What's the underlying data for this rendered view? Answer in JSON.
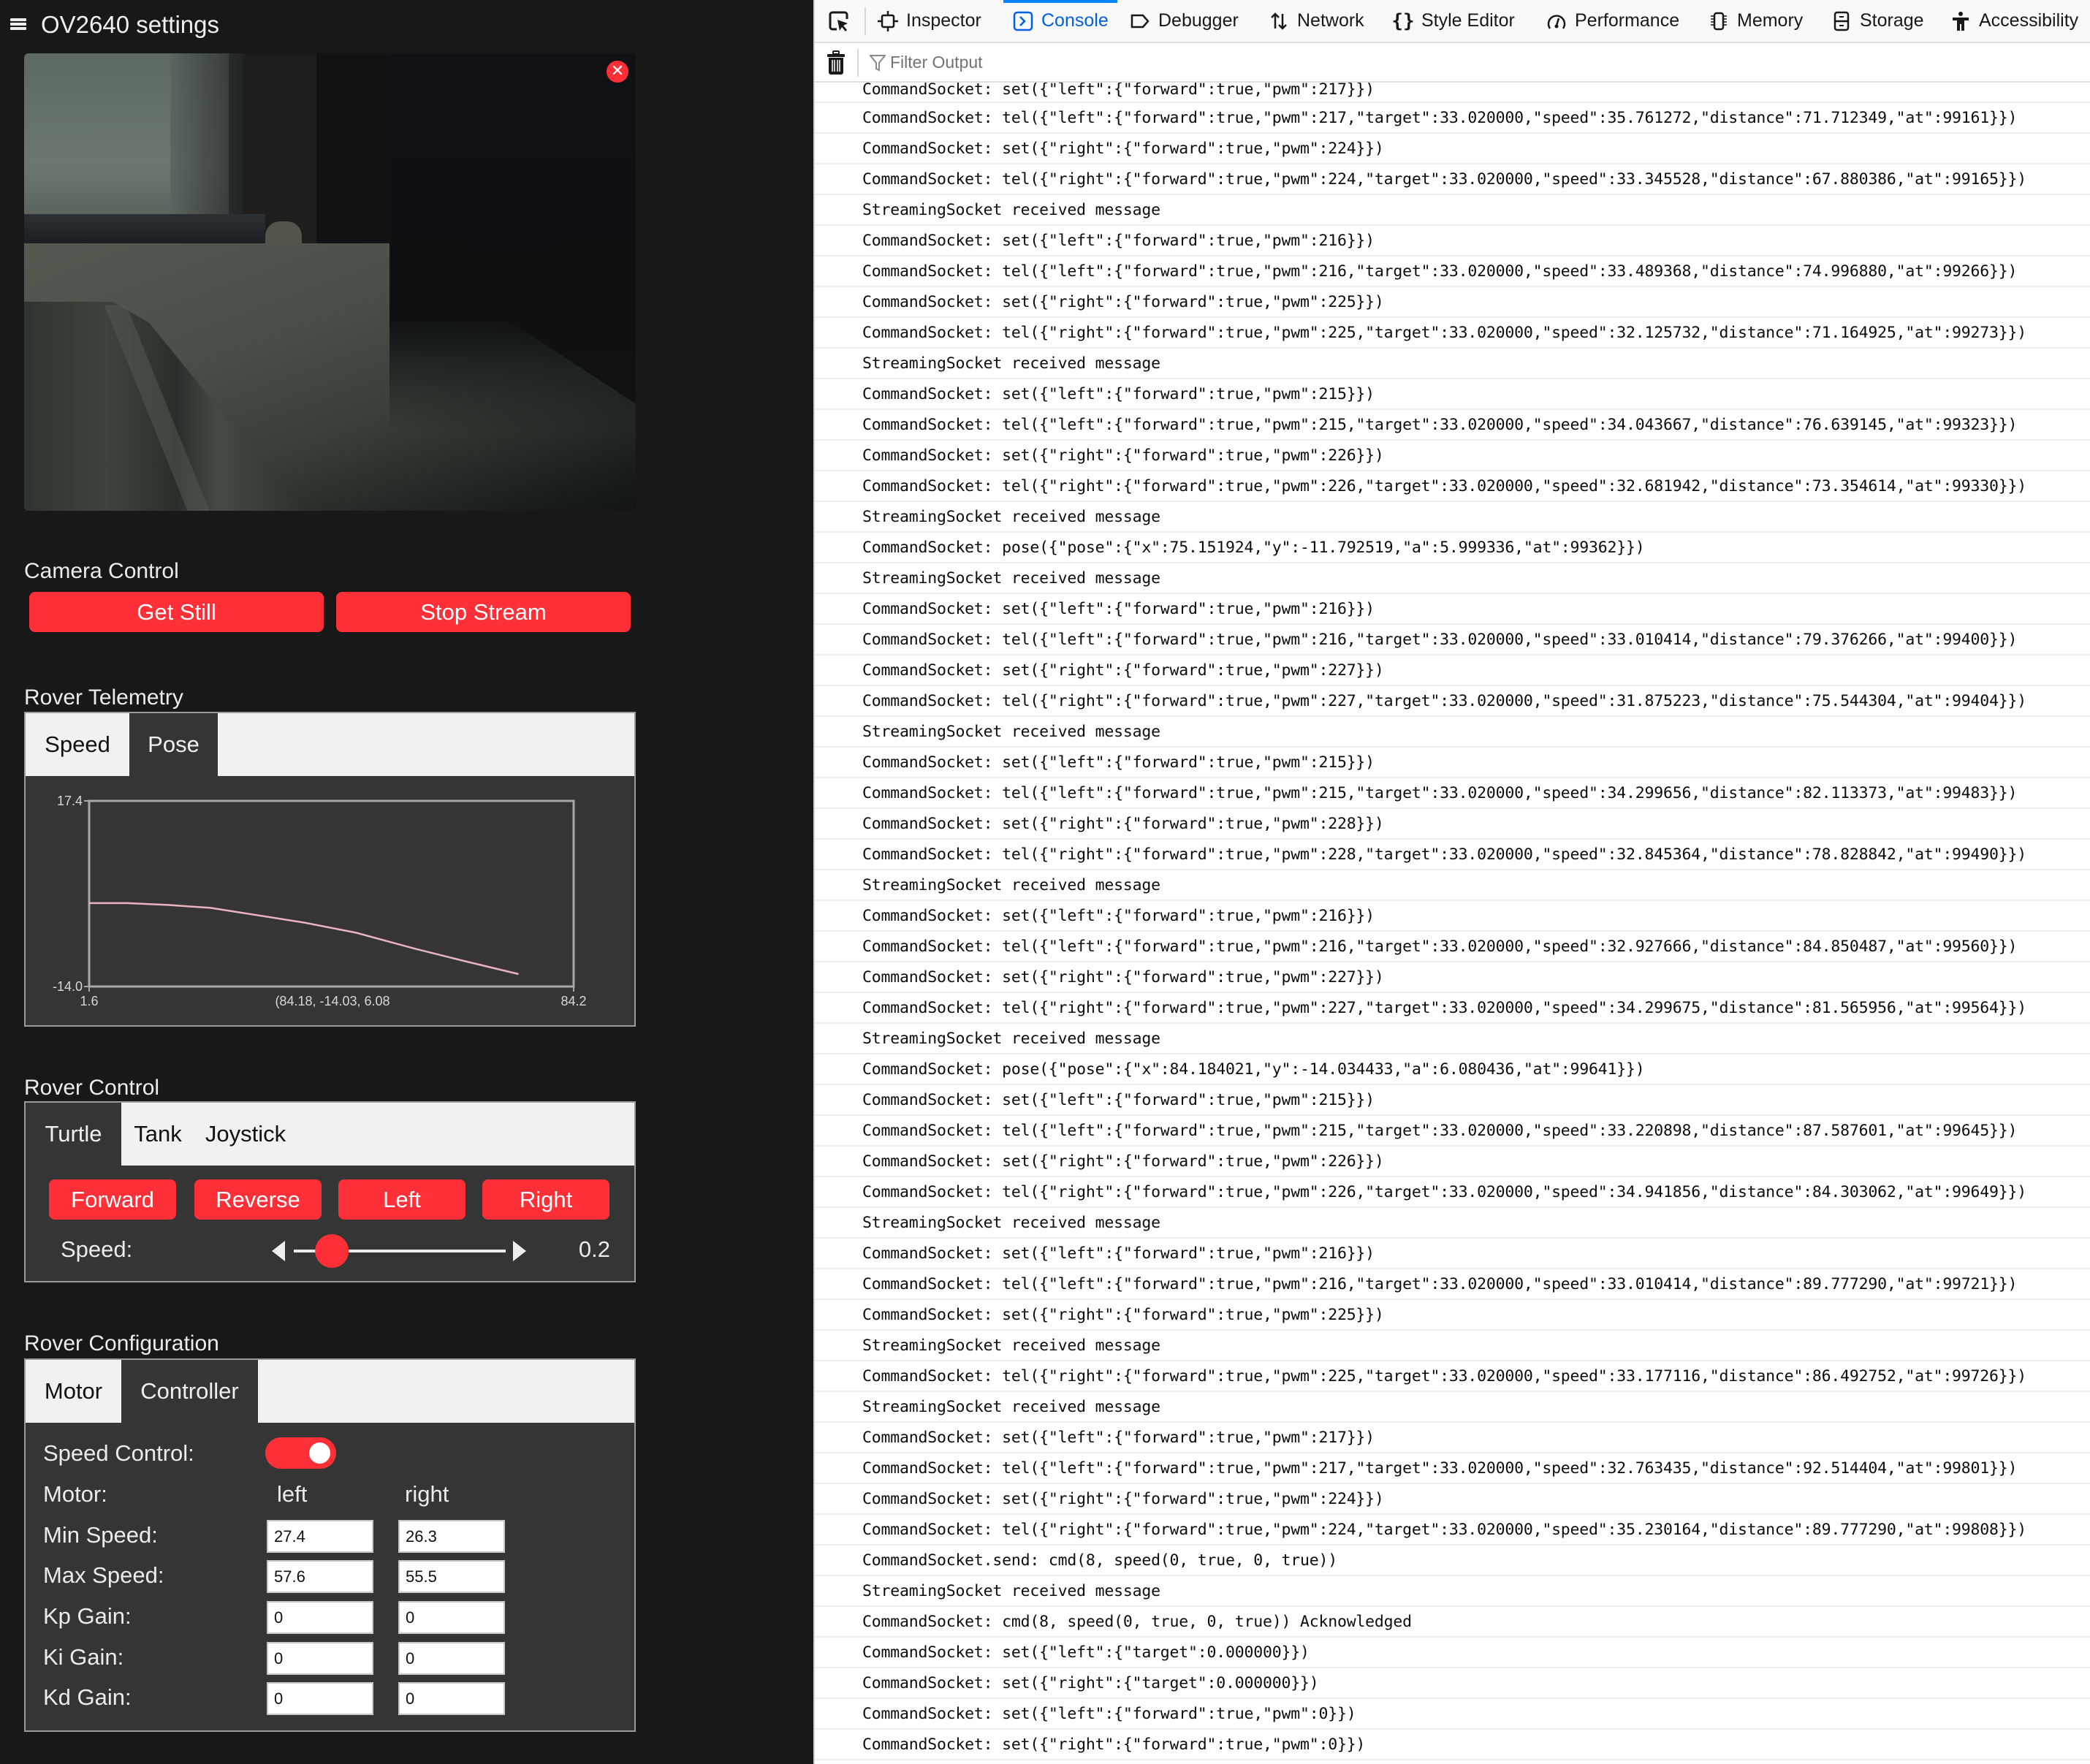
{
  "app": {
    "title": "OV2640 settings",
    "menu_icon": "hamburger-icon",
    "camera": {
      "close_icon": "close-icon",
      "close_glyph": "✕"
    },
    "camera_control": {
      "title": "Camera Control",
      "get_still_label": "Get Still",
      "stop_stream_label": "Stop Stream"
    },
    "telemetry": {
      "title": "Rover Telemetry",
      "tabs": [
        {
          "label": "Speed",
          "active": false
        },
        {
          "label": "Pose",
          "active": true
        }
      ]
    },
    "rover_control": {
      "title": "Rover Control",
      "tabs": [
        {
          "label": "Turtle",
          "active": true
        },
        {
          "label": "Tank",
          "active": false
        },
        {
          "label": "Joystick",
          "active": false
        }
      ],
      "buttons": [
        "Forward",
        "Reverse",
        "Left",
        "Right"
      ],
      "speed_label": "Speed:",
      "speed_value": "0.2",
      "speed_fraction": 0.2
    },
    "rover_config": {
      "title": "Rover Configuration",
      "tabs": [
        {
          "label": "Motor",
          "active": false
        },
        {
          "label": "Controller",
          "active": true
        }
      ],
      "speed_control_label": "Speed Control:",
      "speed_control_on": true,
      "motor_label": "Motor:",
      "left_header": "left",
      "right_header": "right",
      "rows": [
        {
          "label": "Min Speed:",
          "left": "27.4",
          "right": "26.3"
        },
        {
          "label": "Max Speed:",
          "left": "57.6",
          "right": "55.5"
        },
        {
          "label": "Kp Gain:",
          "left": "0",
          "right": "0"
        },
        {
          "label": "Ki Gain:",
          "left": "0",
          "right": "0"
        },
        {
          "label": "Kd Gain:",
          "left": "0",
          "right": "0"
        }
      ]
    },
    "colors": {
      "accent": "#ff2f37",
      "panel": "#353535",
      "background": "#181818",
      "trail": "#e8b4be"
    }
  },
  "chart_data": {
    "type": "line",
    "title": "",
    "xlabel": "",
    "ylabel": "",
    "x_tick_labels": [
      "1.6",
      "84.2"
    ],
    "y_tick_labels": [
      "17.4",
      "-14.0"
    ],
    "xlim": [
      1.6,
      84.2
    ],
    "ylim": [
      -14.0,
      17.4
    ],
    "annotation": "(84.18, -14.03, 6.08",
    "grid": false,
    "series": [
      {
        "name": "pose-trail",
        "x": [
          1.6,
          8.0,
          15.0,
          22.3,
          30.0,
          38.3,
          47.1,
          57.1,
          66.0,
          74.8
        ],
        "y": [
          0.1,
          0.1,
          -0.2,
          -0.7,
          -1.9,
          -3.2,
          -4.9,
          -7.6,
          -9.8,
          -11.9
        ]
      }
    ]
  },
  "devtools": {
    "tabs": [
      {
        "label": "Inspector",
        "icon": "inspector-icon",
        "active": false
      },
      {
        "label": "Console",
        "icon": "console-icon",
        "active": true
      },
      {
        "label": "Debugger",
        "icon": "debugger-icon",
        "active": false
      },
      {
        "label": "Network",
        "icon": "network-icon",
        "active": false
      },
      {
        "label": "Style Editor",
        "icon": "style-editor-icon",
        "active": false
      },
      {
        "label": "Performance",
        "icon": "performance-icon",
        "active": false
      },
      {
        "label": "Memory",
        "icon": "memory-icon",
        "active": false
      },
      {
        "label": "Storage",
        "icon": "storage-icon",
        "active": false
      },
      {
        "label": "Accessibility",
        "icon": "accessibility-icon",
        "active": false
      }
    ],
    "picker_icon": "element-picker-icon",
    "clear_icon": "trash-icon",
    "filter_placeholder": "Filter Output",
    "console_lines": [
      "CommandSocket: set({\"left\":{\"forward\":true,\"pwm\":217}})",
      "CommandSocket: tel({\"left\":{\"forward\":true,\"pwm\":217,\"target\":33.020000,\"speed\":35.761272,\"distance\":71.712349,\"at\":99161}})",
      "CommandSocket: set({\"right\":{\"forward\":true,\"pwm\":224}})",
      "CommandSocket: tel({\"right\":{\"forward\":true,\"pwm\":224,\"target\":33.020000,\"speed\":33.345528,\"distance\":67.880386,\"at\":99165}})",
      "StreamingSocket received message",
      "CommandSocket: set({\"left\":{\"forward\":true,\"pwm\":216}})",
      "CommandSocket: tel({\"left\":{\"forward\":true,\"pwm\":216,\"target\":33.020000,\"speed\":33.489368,\"distance\":74.996880,\"at\":99266}})",
      "CommandSocket: set({\"right\":{\"forward\":true,\"pwm\":225}})",
      "CommandSocket: tel({\"right\":{\"forward\":true,\"pwm\":225,\"target\":33.020000,\"speed\":32.125732,\"distance\":71.164925,\"at\":99273}})",
      "StreamingSocket received message",
      "CommandSocket: set({\"left\":{\"forward\":true,\"pwm\":215}})",
      "CommandSocket: tel({\"left\":{\"forward\":true,\"pwm\":215,\"target\":33.020000,\"speed\":34.043667,\"distance\":76.639145,\"at\":99323}})",
      "CommandSocket: set({\"right\":{\"forward\":true,\"pwm\":226}})",
      "CommandSocket: tel({\"right\":{\"forward\":true,\"pwm\":226,\"target\":33.020000,\"speed\":32.681942,\"distance\":73.354614,\"at\":99330}})",
      "StreamingSocket received message",
      "CommandSocket: pose({\"pose\":{\"x\":75.151924,\"y\":-11.792519,\"a\":5.999336,\"at\":99362}})",
      "StreamingSocket received message",
      "CommandSocket: set({\"left\":{\"forward\":true,\"pwm\":216}})",
      "CommandSocket: tel({\"left\":{\"forward\":true,\"pwm\":216,\"target\":33.020000,\"speed\":33.010414,\"distance\":79.376266,\"at\":99400}})",
      "CommandSocket: set({\"right\":{\"forward\":true,\"pwm\":227}})",
      "CommandSocket: tel({\"right\":{\"forward\":true,\"pwm\":227,\"target\":33.020000,\"speed\":31.875223,\"distance\":75.544304,\"at\":99404}})",
      "StreamingSocket received message",
      "CommandSocket: set({\"left\":{\"forward\":true,\"pwm\":215}})",
      "CommandSocket: tel({\"left\":{\"forward\":true,\"pwm\":215,\"target\":33.020000,\"speed\":34.299656,\"distance\":82.113373,\"at\":99483}})",
      "CommandSocket: set({\"right\":{\"forward\":true,\"pwm\":228}})",
      "CommandSocket: tel({\"right\":{\"forward\":true,\"pwm\":228,\"target\":33.020000,\"speed\":32.845364,\"distance\":78.828842,\"at\":99490}})",
      "StreamingSocket received message",
      "CommandSocket: set({\"left\":{\"forward\":true,\"pwm\":216}})",
      "CommandSocket: tel({\"left\":{\"forward\":true,\"pwm\":216,\"target\":33.020000,\"speed\":32.927666,\"distance\":84.850487,\"at\":99560}})",
      "CommandSocket: set({\"right\":{\"forward\":true,\"pwm\":227}})",
      "CommandSocket: tel({\"right\":{\"forward\":true,\"pwm\":227,\"target\":33.020000,\"speed\":34.299675,\"distance\":81.565956,\"at\":99564}})",
      "StreamingSocket received message",
      "CommandSocket: pose({\"pose\":{\"x\":84.184021,\"y\":-14.034433,\"a\":6.080436,\"at\":99641}})",
      "CommandSocket: set({\"left\":{\"forward\":true,\"pwm\":215}})",
      "CommandSocket: tel({\"left\":{\"forward\":true,\"pwm\":215,\"target\":33.020000,\"speed\":33.220898,\"distance\":87.587601,\"at\":99645}})",
      "CommandSocket: set({\"right\":{\"forward\":true,\"pwm\":226}})",
      "CommandSocket: tel({\"right\":{\"forward\":true,\"pwm\":226,\"target\":33.020000,\"speed\":34.941856,\"distance\":84.303062,\"at\":99649}})",
      "StreamingSocket received message",
      "CommandSocket: set({\"left\":{\"forward\":true,\"pwm\":216}})",
      "CommandSocket: tel({\"left\":{\"forward\":true,\"pwm\":216,\"target\":33.020000,\"speed\":33.010414,\"distance\":89.777290,\"at\":99721}})",
      "CommandSocket: set({\"right\":{\"forward\":true,\"pwm\":225}})",
      "StreamingSocket received message",
      "CommandSocket: tel({\"right\":{\"forward\":true,\"pwm\":225,\"target\":33.020000,\"speed\":33.177116,\"distance\":86.492752,\"at\":99726}})",
      "StreamingSocket received message",
      "CommandSocket: set({\"left\":{\"forward\":true,\"pwm\":217}})",
      "CommandSocket: tel({\"left\":{\"forward\":true,\"pwm\":217,\"target\":33.020000,\"speed\":32.763435,\"distance\":92.514404,\"at\":99801}})",
      "CommandSocket: set({\"right\":{\"forward\":true,\"pwm\":224}})",
      "CommandSocket: tel({\"right\":{\"forward\":true,\"pwm\":224,\"target\":33.020000,\"speed\":35.230164,\"distance\":89.777290,\"at\":99808}})",
      "CommandSocket.send: cmd(8, speed(0, true, 0, true))",
      "StreamingSocket received message",
      "CommandSocket: cmd(8, speed(0, true, 0, true)) Acknowledged",
      "CommandSocket: set({\"left\":{\"target\":0.000000}})",
      "CommandSocket: set({\"right\":{\"target\":0.000000}})",
      "CommandSocket: set({\"left\":{\"forward\":true,\"pwm\":0}})",
      "CommandSocket: set({\"right\":{\"forward\":true,\"pwm\":0}})"
    ]
  }
}
